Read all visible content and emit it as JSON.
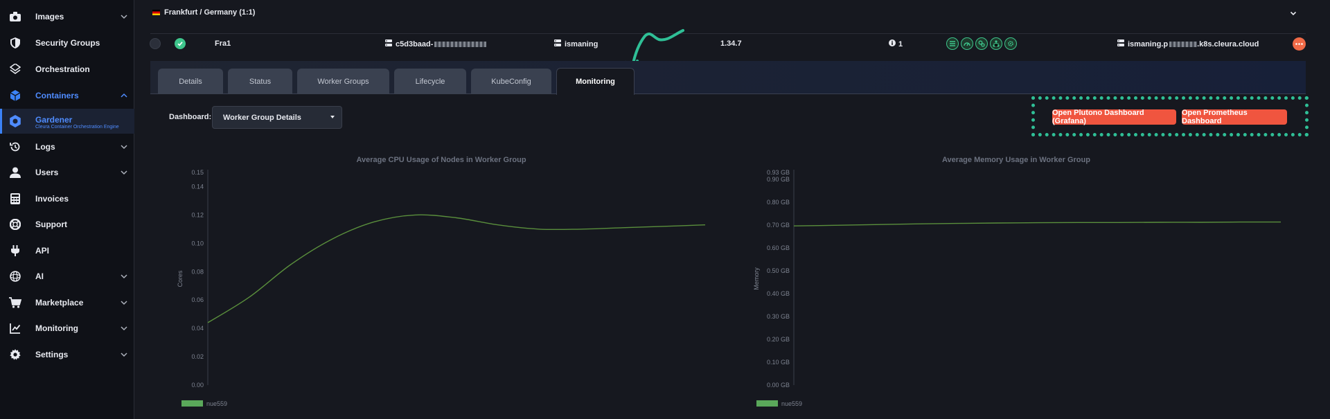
{
  "sidebar": {
    "items": [
      {
        "label": "Images",
        "icon": "camera-icon",
        "has_chevron": true
      },
      {
        "label": "Security Groups",
        "icon": "shield-icon",
        "has_chevron": false
      },
      {
        "label": "Orchestration",
        "icon": "orchestration-icon",
        "has_chevron": false
      },
      {
        "label": "Containers",
        "icon": "cube-icon",
        "has_chevron": true,
        "active": true
      },
      {
        "label": "Logs",
        "icon": "history-icon",
        "has_chevron": true
      },
      {
        "label": "Users",
        "icon": "user-icon",
        "has_chevron": true
      },
      {
        "label": "Invoices",
        "icon": "calculator-icon",
        "has_chevron": false
      },
      {
        "label": "Support",
        "icon": "lifebuoy-icon",
        "has_chevron": false
      },
      {
        "label": "API",
        "icon": "plug-icon",
        "has_chevron": false
      },
      {
        "label": "AI",
        "icon": "ai-icon",
        "has_chevron": true
      },
      {
        "label": "Marketplace",
        "icon": "cart-icon",
        "has_chevron": true
      },
      {
        "label": "Monitoring",
        "icon": "chart-line-icon",
        "has_chevron": true
      },
      {
        "label": "Settings",
        "icon": "gear-icon",
        "has_chevron": true
      }
    ],
    "subitem": {
      "label": "Gardener",
      "sublabel": "Cleura Container Orchestration Engine",
      "icon": "gardener-icon"
    }
  },
  "region": {
    "label": "Frankfurt / Germany (1:1)"
  },
  "cluster": {
    "name": "Fra1",
    "id_prefix": "c5d3baad-",
    "project": "ismaning",
    "version": "1.34.7",
    "info_count": "1",
    "domain_prefix": "ismaning.p",
    "domain_suffix": ".k8s.cleura.cloud"
  },
  "tabs": [
    {
      "label": "Details"
    },
    {
      "label": "Status"
    },
    {
      "label": "Worker Groups"
    },
    {
      "label": "Lifecycle"
    },
    {
      "label": "KubeConfig"
    },
    {
      "label": "Monitoring",
      "active": true
    }
  ],
  "dashboard": {
    "label": "Dashboard:",
    "selected": "Worker Group Details",
    "buttons": {
      "plutono": "Open Plutono Dashboard (Grafana)",
      "prometheus": "Open Prometheus Dashboard"
    }
  },
  "colors": {
    "accent_blue": "#4f8cff",
    "accent_orange": "#f0553f",
    "status_green": "#3ec58c",
    "annotation_teal": "#2fbf96",
    "series_green": "#5a8f3c"
  },
  "chart_data": [
    {
      "type": "line",
      "title": "Average CPU Usage of Nodes in Worker Group",
      "ylabel": "Cores",
      "ylim": [
        0,
        0.15
      ],
      "yticks": [
        "0.00",
        "0.02",
        "0.04",
        "0.06",
        "0.08",
        "0.10",
        "0.12",
        "0.14",
        "0.15"
      ],
      "ytick_values": [
        0,
        0.02,
        0.04,
        0.06,
        0.08,
        0.1,
        0.12,
        0.14,
        0.15
      ],
      "series": [
        {
          "name": "nue559",
          "values": [
            0.044,
            0.062,
            0.085,
            0.103,
            0.115,
            0.12,
            0.118,
            0.113,
            0.11,
            0.11,
            0.111,
            0.112,
            0.113
          ]
        }
      ],
      "grid": false,
      "legend": "bottom-left"
    },
    {
      "type": "line",
      "title": "Average Memory Usage in Worker Group",
      "ylabel": "Memory",
      "ylim": [
        0,
        0.93
      ],
      "yticks": [
        "0.00 GB",
        "0.10 GB",
        "0.20 GB",
        "0.30 GB",
        "0.40 GB",
        "0.50 GB",
        "0.60 GB",
        "0.70 GB",
        "0.80 GB",
        "0.90 GB",
        "0.93 GB"
      ],
      "ytick_values": [
        0,
        0.1,
        0.2,
        0.3,
        0.4,
        0.5,
        0.6,
        0.7,
        0.8,
        0.9,
        0.93
      ],
      "series": [
        {
          "name": "nue559",
          "values": [
            0.696,
            0.699,
            0.702,
            0.705,
            0.707,
            0.709,
            0.71,
            0.711,
            0.711,
            0.712,
            0.712,
            0.713,
            0.713
          ]
        }
      ],
      "grid": false,
      "legend": "bottom-left"
    }
  ]
}
